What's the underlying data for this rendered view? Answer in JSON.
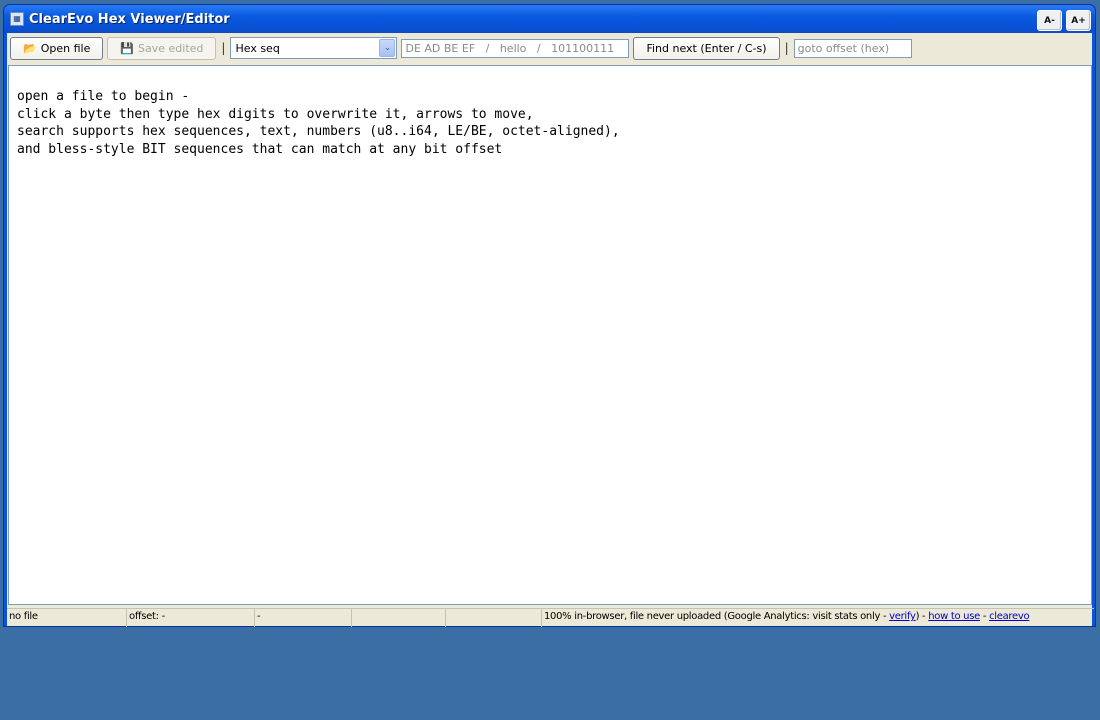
{
  "window": {
    "title": "ClearEvo Hex Viewer/Editor",
    "icon": "hex-app-icon",
    "font_smaller": "A-",
    "font_larger": "A+"
  },
  "toolbar": {
    "open_label": "Open file",
    "open_icon": "folder-icon",
    "save_label": "Save edited",
    "save_icon": "floppy-disk-icon",
    "separator": "|",
    "mode_selected": "Hex seq",
    "search_placeholder": "DE AD BE EF   /   hello   /   101100111",
    "find_label": "Find next (Enter / C-s)",
    "goto_placeholder": "goto offset (hex)"
  },
  "viewer": {
    "lines": [
      "open a file to begin -",
      "click a byte then type hex digits to overwrite it, arrows to move,",
      "search supports hex sequences, text, numbers (u8..i64, LE/BE, octet-aligned),",
      "and bless-style BIT sequences that can match at any bit offset"
    ]
  },
  "status": {
    "file": "no file",
    "offset": "offset: -",
    "value": "-",
    "empty1": "",
    "empty2": "",
    "note_prefix": "100% in-browser, file never uploaded (Google Analytics: visit stats only - ",
    "verify_link": "verify",
    "note_mid": ") - ",
    "howto_link": "how to use",
    "dash": " - ",
    "clearevo_link": "clearevo"
  },
  "colors": {
    "desktop": "#3a6ea5",
    "titlebar": "#0a5adf",
    "client": "#ece9d8"
  }
}
